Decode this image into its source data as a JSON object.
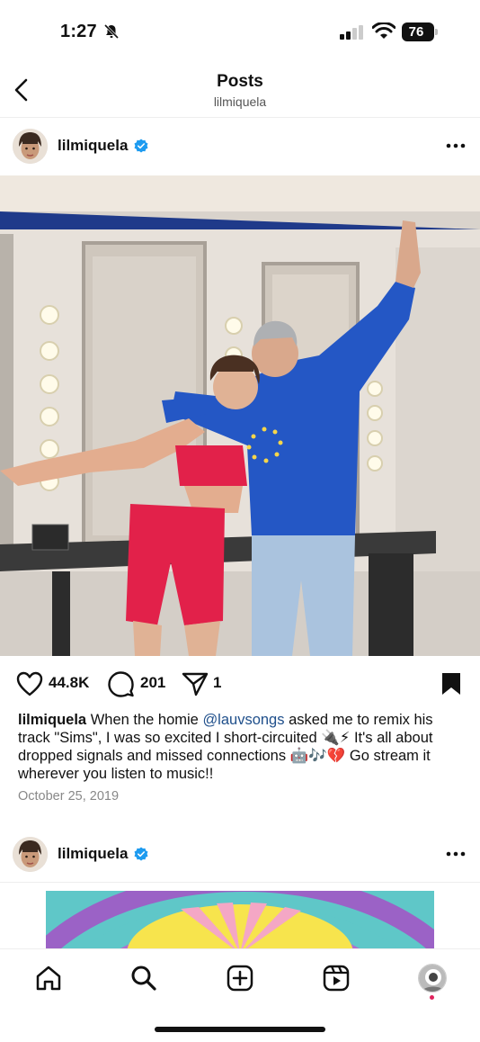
{
  "status_bar": {
    "time": "1:27",
    "battery": "76"
  },
  "header": {
    "title": "Posts",
    "subtitle": "lilmiquela"
  },
  "post": {
    "username": "lilmiquela",
    "likes": "44.8K",
    "comments": "201",
    "shares": "1",
    "caption": {
      "username": "lilmiquela",
      "text_before": " When the homie ",
      "mention": "@lauvsongs",
      "text_after": " asked me to remix his track \"Sims\", I was so excited I short-circuited 🔌⚡ It's all about dropped signals and missed connections 🤖🎶💔 Go stream it wherever you listen to music!!"
    },
    "date": "October 25, 2019"
  },
  "next_post": {
    "username": "lilmiquela"
  },
  "colors": {
    "verified": "#1d9bf0",
    "accent_dot": "#e0245e",
    "mention": "#1f4f8b"
  }
}
